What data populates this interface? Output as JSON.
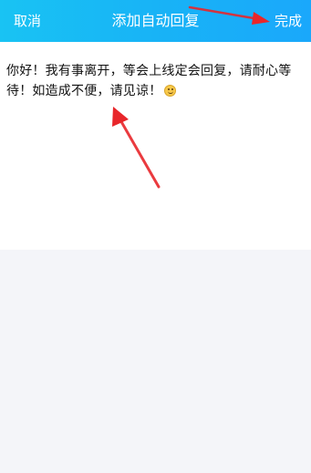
{
  "header": {
    "cancel_label": "取消",
    "title": "添加自动回复",
    "done_label": "完成"
  },
  "editor": {
    "message": "你好！我有事离开，等会上线定会回复，请耐心等待！如造成不便，请见谅！",
    "emoji_icon": "smile-emoji-icon"
  },
  "colors": {
    "header_start": "#19c3f3",
    "header_end": "#1aa8fb",
    "annotation_arrow": "#e8262a",
    "page_background": "#f4f5f9"
  }
}
